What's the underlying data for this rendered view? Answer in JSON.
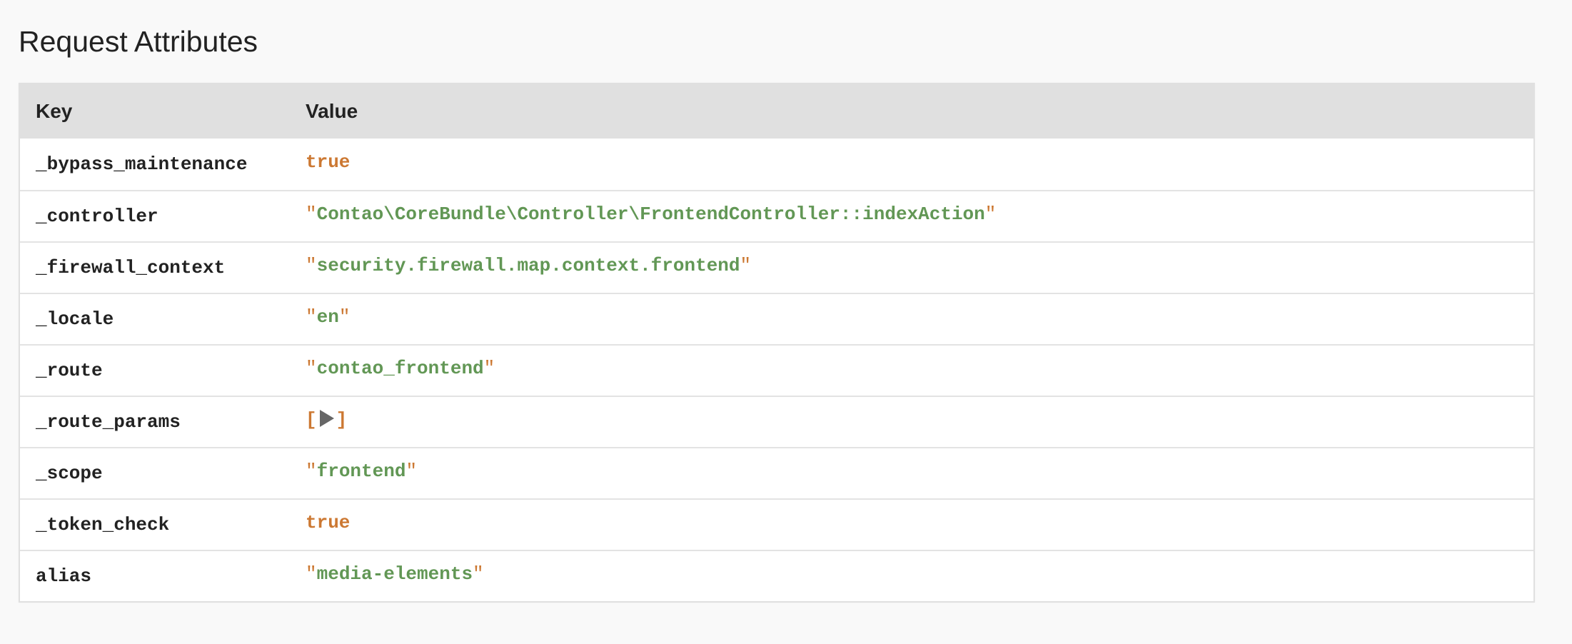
{
  "page": {
    "title": "Request Attributes"
  },
  "table": {
    "headers": {
      "key": "Key",
      "value": "Value"
    },
    "rows": [
      {
        "key": "_bypass_maintenance",
        "type": "bool",
        "value": "true"
      },
      {
        "key": "_controller",
        "type": "string",
        "value": "Contao\\CoreBundle\\Controller\\FrontendController::indexAction"
      },
      {
        "key": "_firewall_context",
        "type": "string",
        "value": "security.firewall.map.context.frontend"
      },
      {
        "key": "_locale",
        "type": "string",
        "value": "en"
      },
      {
        "key": "_route",
        "type": "string",
        "value": "contao_frontend"
      },
      {
        "key": "_route_params",
        "type": "array",
        "value_open": "[",
        "value_close": "]",
        "toggle_icon": "play-triangle-icon"
      },
      {
        "key": "_scope",
        "type": "string",
        "value": "frontend"
      },
      {
        "key": "_token_check",
        "type": "bool",
        "value": "true"
      },
      {
        "key": "alias",
        "type": "string",
        "value": "media-elements"
      }
    ]
  },
  "colors": {
    "bool": "#cc7832",
    "string": "#629755",
    "quote": "#cc7832",
    "header_bg": "#e0e0e0",
    "page_bg": "#f9f9f9"
  },
  "quote_char": "\""
}
